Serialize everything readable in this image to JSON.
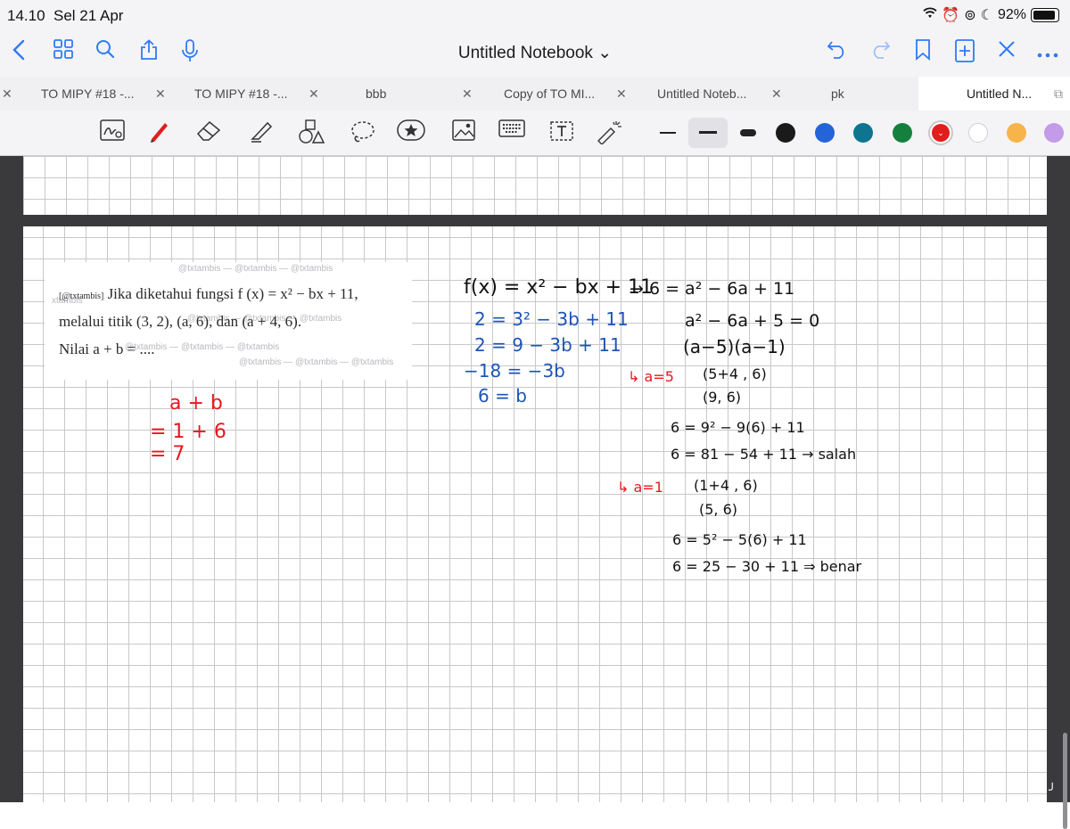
{
  "status_bar": {
    "time": "14.10",
    "date": "Sel 21 Apr",
    "battery": "92%"
  },
  "toolbar": {
    "title": "Untitled Notebook ⌄"
  },
  "tabs": [
    {
      "label": "TO MIPY #18 -..."
    },
    {
      "label": "TO MIPY #18 -..."
    },
    {
      "label": "bbb"
    },
    {
      "label": "Copy of TO MI..."
    },
    {
      "label": "Untitled Noteb..."
    },
    {
      "label": "pk"
    },
    {
      "label": "Untitled N..."
    }
  ],
  "pen_colors": [
    "#1a1a1a",
    "#2563d9",
    "#0e7490",
    "#15803d",
    "#e11d1d",
    "#ffffff",
    "#f6b44a",
    "#c39be8"
  ],
  "problem": {
    "tag": "[@txtambis]",
    "line1": "Jika diketahui fungsi f (x)  =  x²  −  bx  +  11,",
    "line2": "melalui titik (3, 2), (a, 6), dan (a + 4, 6).",
    "line3": "Nilai a + b = ....",
    "watermark": "@txtambis — @txtambis — @txtambis"
  },
  "handwriting": {
    "answer": [
      "a + b",
      "=  1 + 6",
      "= 7"
    ],
    "left_work": [
      "f(x) = x² − bx + 11",
      "2 = 3² − 3b + 11",
      "2 =  9 − 3b + 11",
      "−18 = −3b",
      "6 = b"
    ],
    "right_work": [
      "→  6 = a² − 6a + 11",
      "a² − 6a + 5 = 0",
      "(a−5)(a−1)",
      "↳ a=5",
      "(5+4 , 6)",
      "(9, 6)",
      "6 = 9² − 9(6) + 11",
      "6 = 81 − 54 + 11 → salah",
      "↳ a=1",
      "(1+4 , 6)",
      "(5, 6)",
      "6 = 5² − 5(6) + 11",
      "6 = 25 − 30 + 11  ⇒ benar"
    ]
  }
}
